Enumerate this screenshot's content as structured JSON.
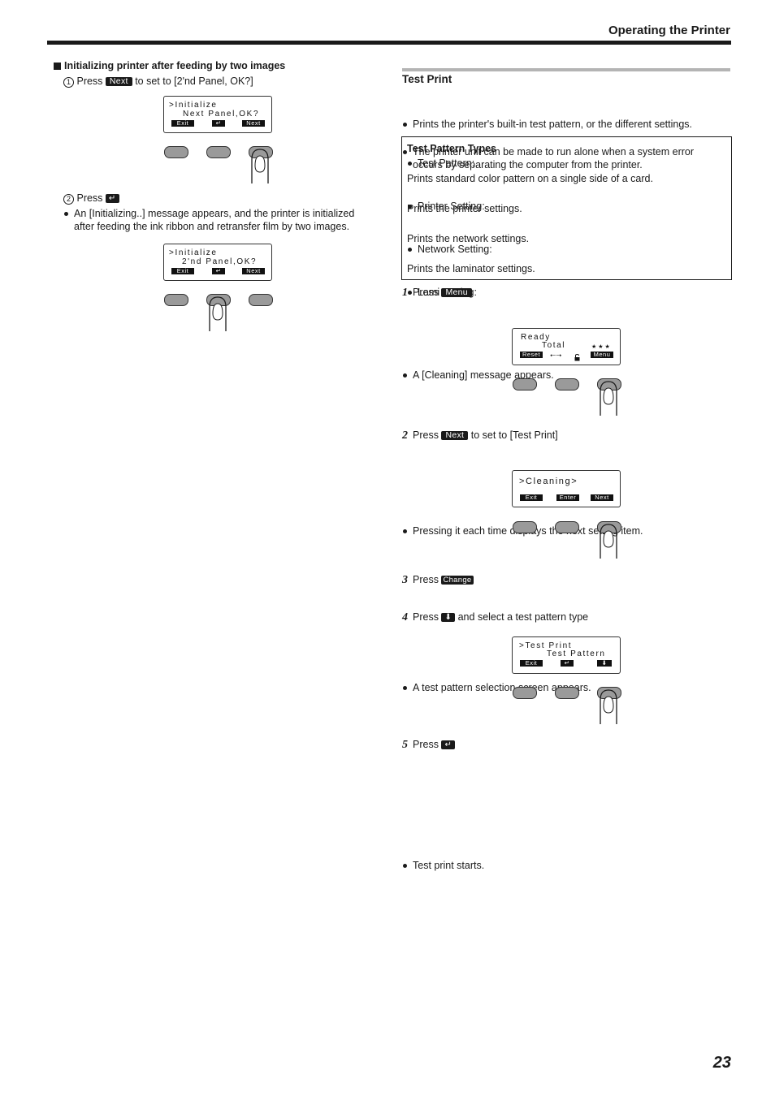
{
  "header": {
    "title": "Operating the Printer"
  },
  "left": {
    "section_title": "Initializing printer after feeding by two images",
    "step1": {
      "num": "1",
      "prefix": "Press",
      "key": "Next",
      "suffix": "to set to [2'nd Panel, OK?]"
    },
    "panel1": {
      "line1": ">Initialize",
      "line2": "Next Panel,OK?",
      "keys": [
        "Exit",
        "↵",
        "Next"
      ],
      "pressed_button": 3
    },
    "step2": {
      "num": "2",
      "prefix": "Press",
      "key": "↵"
    },
    "step2_note_line1": "An [Initializing..] message appears, and the printer is initialized",
    "step2_note_line2": "after feeding the ink ribbon and retransfer film by two images.",
    "panel2": {
      "line1": ">Initialize",
      "line2": "2'nd Panel,OK?",
      "keys": [
        "Exit",
        "↵",
        "Next"
      ],
      "pressed_button": 2
    }
  },
  "right": {
    "section_title": "Test Print",
    "bullets": [
      "Prints the printer's built-in test pattern, or the different settings.",
      "The printer unit can be made to run alone when a system error",
      "occurs by separating the computer from the printer."
    ],
    "types_box": {
      "title": "Test Pattern Types",
      "items": [
        {
          "name": "Test Pattern:",
          "desc": "Prints standard color pattern on a single side of a card."
        },
        {
          "name": "Printer Setting:",
          "desc": "Prints the printer settings."
        },
        {
          "name": "Network Setting:",
          "desc": "Prints the network settings."
        },
        {
          "name": "Lami Setting:",
          "desc": "Prints the laminator settings."
        }
      ]
    },
    "steps": [
      {
        "num": "1",
        "prefix": "Press",
        "key": "Menu",
        "suffix": "",
        "note": "A [Cleaning] message appears."
      },
      {
        "num": "2",
        "prefix": "Press",
        "key": "Next",
        "suffix": "to set to [Test Print]",
        "note": "Pressing it each time displays the next setting item."
      },
      {
        "num": "3",
        "prefix": "Press",
        "key": "Change",
        "suffix": "",
        "note": "A test pattern selection screen appears."
      },
      {
        "num": "4",
        "prefix": "Press",
        "key": "⬇",
        "suffix": "and select a test pattern type",
        "note": ""
      },
      {
        "num": "5",
        "prefix": "Press",
        "key": "↵",
        "suffix": "",
        "note": "Test print starts."
      }
    ],
    "panel_ready": {
      "line1": "Ready",
      "line2": "Total",
      "stars": "★ ★ ★",
      "keys": [
        "Reset",
        "•←→",
        "🔓",
        "Menu"
      ],
      "pressed_button": 3
    },
    "panel_cleaning": {
      "line1": ">Cleaning>",
      "keys": [
        "Exit",
        "Enter",
        "Next"
      ],
      "pressed_button": 3
    },
    "panel_testprint": {
      "line1": ">Test Print",
      "line2": "Test Pattern",
      "keys": [
        "Exit",
        "↵",
        "⬇"
      ],
      "pressed_button": 3
    }
  },
  "page_number": "23"
}
